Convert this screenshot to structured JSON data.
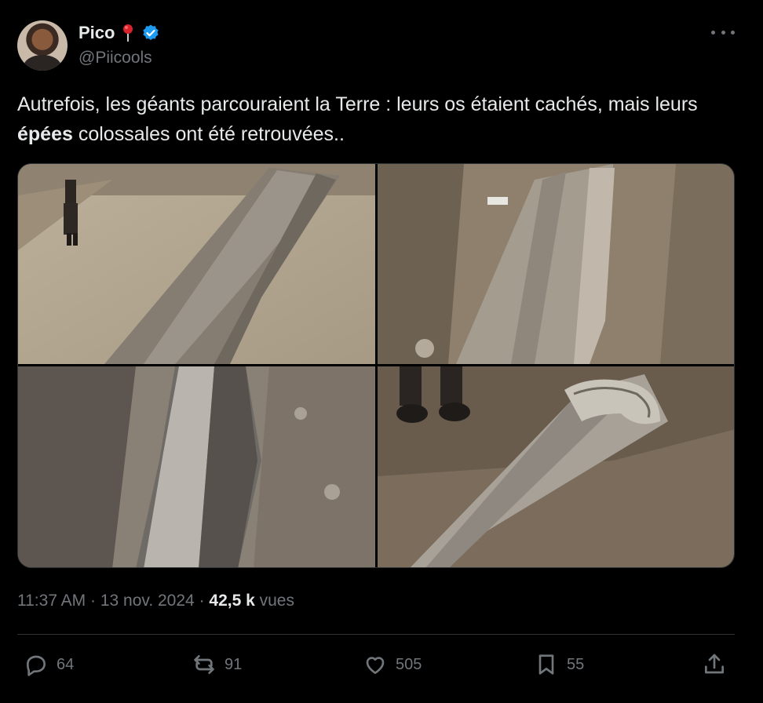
{
  "author": {
    "display_name": "Pico",
    "handle": "@Piicools",
    "badge_emoji": "pin-icon",
    "verified_color": "#1d9bf0"
  },
  "tweet": {
    "text_before": "Autrefois, les géants parcouraient la Terre : leurs os étaient cachés, mais leurs ",
    "text_bold": "épées",
    "text_after": " colossales ont été retrouvées.."
  },
  "media": {
    "images": [
      {
        "name": "giant-sword-excavation-with-person"
      },
      {
        "name": "stone-sword-in-trench"
      },
      {
        "name": "sword-blade-in-soil"
      },
      {
        "name": "ornate-sword-hilt-with-feet"
      }
    ]
  },
  "meta": {
    "time": "11:37 AM",
    "separator": " · ",
    "date": "13 nov. 2024",
    "views_count": "42,5 k",
    "views_label": " vues"
  },
  "actions": {
    "replies": "64",
    "reposts": "91",
    "likes": "505",
    "bookmarks": "55"
  },
  "colors": {
    "background": "#000000",
    "text": "#e7e9ea",
    "muted": "#71767b",
    "border": "#2f3336",
    "accent": "#1d9bf0"
  }
}
